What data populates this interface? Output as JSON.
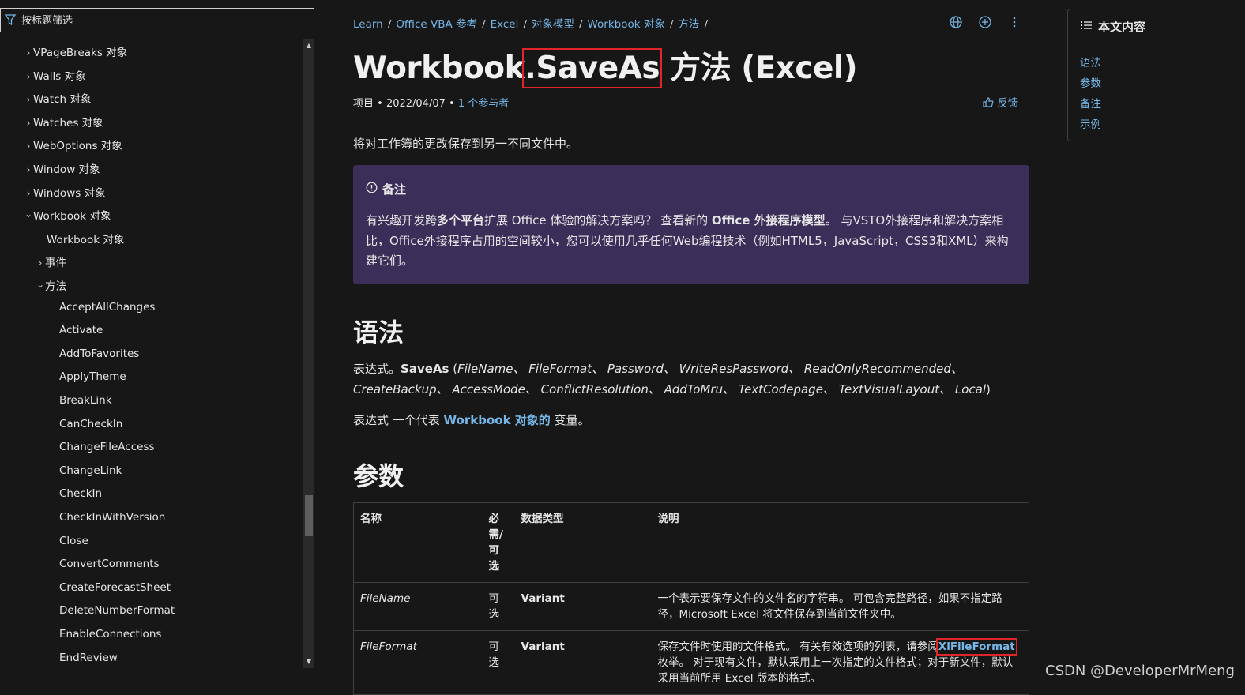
{
  "sidebar": {
    "filter_placeholder": "按标题筛选",
    "items": [
      {
        "label": "VPageBreaks 对象",
        "chevron": "right"
      },
      {
        "label": "Walls 对象",
        "chevron": "right"
      },
      {
        "label": "Watch 对象",
        "chevron": "right"
      },
      {
        "label": "Watches 对象",
        "chevron": "right"
      },
      {
        "label": "WebOptions 对象",
        "chevron": "right"
      },
      {
        "label": "Window 对象",
        "chevron": "right"
      },
      {
        "label": "Windows 对象",
        "chevron": "right"
      },
      {
        "label": "Workbook 对象",
        "chevron": "down"
      },
      {
        "label": "Workbook 对象",
        "chevron": ""
      },
      {
        "label": "事件",
        "chevron": "right"
      },
      {
        "label": "方法",
        "chevron": "down"
      },
      {
        "label": "AcceptAllChanges",
        "chevron": ""
      },
      {
        "label": "Activate",
        "chevron": ""
      },
      {
        "label": "AddToFavorites",
        "chevron": ""
      },
      {
        "label": "ApplyTheme",
        "chevron": ""
      },
      {
        "label": "BreakLink",
        "chevron": ""
      },
      {
        "label": "CanCheckIn",
        "chevron": ""
      },
      {
        "label": "ChangeFileAccess",
        "chevron": ""
      },
      {
        "label": "ChangeLink",
        "chevron": ""
      },
      {
        "label": "CheckIn",
        "chevron": ""
      },
      {
        "label": "CheckInWithVersion",
        "chevron": ""
      },
      {
        "label": "Close",
        "chevron": ""
      },
      {
        "label": "ConvertComments",
        "chevron": ""
      },
      {
        "label": "CreateForecastSheet",
        "chevron": ""
      },
      {
        "label": "DeleteNumberFormat",
        "chevron": ""
      },
      {
        "label": "EnableConnections",
        "chevron": ""
      },
      {
        "label": "EndReview",
        "chevron": ""
      }
    ]
  },
  "breadcrumb": [
    "Learn",
    "Office VBA 参考",
    "Excel",
    "对象模型",
    "Workbook 对象",
    "方法"
  ],
  "title": {
    "prefix": "Workbook",
    "highlight": ".SaveAs",
    "suffix": " 方法 (Excel)"
  },
  "meta": {
    "kind": "项目",
    "date": "2022/04/07",
    "contributors": "1 个参与者",
    "feedback": "反馈"
  },
  "summary": "将对工作簿的更改保存到另一不同文件中。",
  "note": {
    "heading": "备注",
    "parts": [
      {
        "t": "有兴趣开发跨",
        "b": false
      },
      {
        "t": "多个平台",
        "b": true
      },
      {
        "t": "扩展 Office 体验的解决方案吗？ 查看新的 ",
        "b": false
      },
      {
        "t": "Office 外接程序模型",
        "b": true
      },
      {
        "t": "。 与VSTO外接程序和解决方案相比，Office外接程序占用的空间较小，您可以使用几乎任何Web编程技术（例如HTML5，JavaScript，CSS3和XML）来构建它们。",
        "b": false
      }
    ]
  },
  "syntax": {
    "heading": "语法",
    "expr_prefix": "表达式。",
    "method": "SaveAs",
    "params_text": "FileName、 FileFormat、 Password、 WriteResPassword、 ReadOnlyRecommended、 CreateBackup、 AccessMode、 ConflictResolution、 AddToMru、 TextCodepage、 TextVisualLayout、 Local",
    "desc_prefix": "表达式 一个代表 ",
    "desc_link": "Workbook 对象的",
    "desc_suffix": " 变量。"
  },
  "parameters": {
    "heading": "参数",
    "columns": [
      "名称",
      "必需/可选",
      "数据类型",
      "说明"
    ],
    "rows": [
      {
        "name": "FileName",
        "req": "可选",
        "type": "Variant",
        "desc": "一个表示要保存文件的文件名的字符串。 可包含完整路径，如果不指定路径，Microsoft Excel 将文件保存到当前文件夹中。",
        "desc_link": "",
        "desc_after": ""
      },
      {
        "name": "FileFormat",
        "req": "可选",
        "type": "Variant",
        "desc": "保存文件时使用的文件格式。 有关有效选项的列表，请参阅",
        "desc_link": "XlFileFormat",
        "desc_after": "枚举。 对于现有文件，默认采用上一次指定的文件格式；对于新文件，默认采用当前所用 Excel 版本的格式。"
      }
    ]
  },
  "on_page": {
    "heading": "本文内容",
    "items": [
      "语法",
      "参数",
      "备注",
      "示例"
    ]
  },
  "watermark": "CSDN @DeveloperMrMeng",
  "colors": {
    "background": "#171717",
    "link": "#75b6e7",
    "note_bg": "#3b2e58",
    "highlight_box": "#e0262b"
  }
}
